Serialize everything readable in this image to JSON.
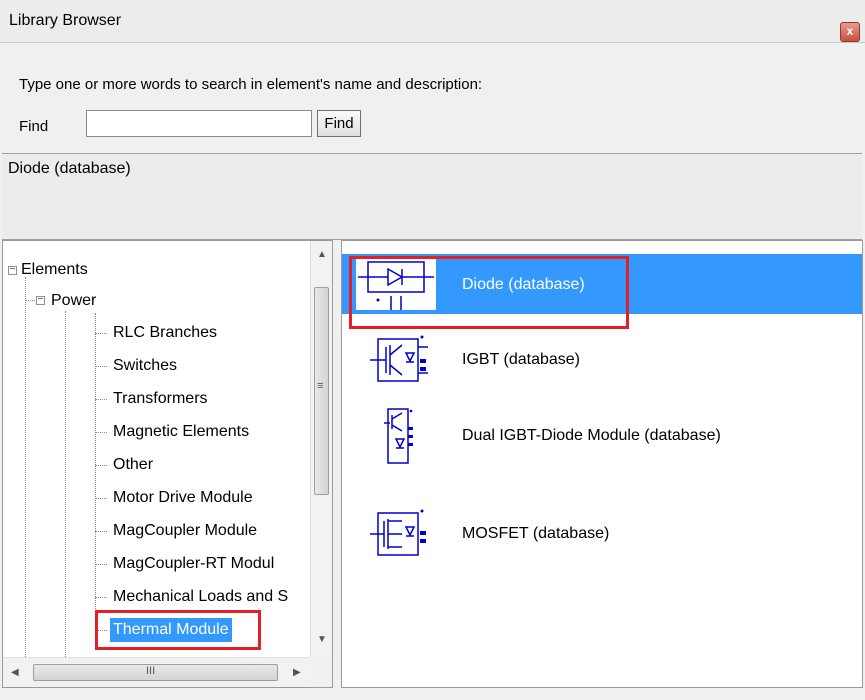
{
  "window": {
    "title": "Library Browser",
    "close_glyph": "x"
  },
  "search": {
    "instruction": "Type one or more words to search in element's name and  description:",
    "find_label": "Find",
    "find_value": "",
    "find_button": "Find"
  },
  "description": {
    "text": "Diode (database)"
  },
  "tree": {
    "root": "Elements",
    "power": "Power",
    "items": [
      "RLC Branches",
      "Switches",
      "Transformers",
      "Magnetic Elements",
      "Other",
      "Motor Drive Module",
      "MagCoupler Module",
      "MagCoupler-RT Modul",
      "Mechanical Loads and S",
      "Thermal Module"
    ],
    "selected_item": "Thermal Module",
    "scroll_h_glyph": "III",
    "scroll_v_glyph": "≡"
  },
  "list": {
    "items": [
      {
        "label": "Diode (database)",
        "icon": "diode-icon",
        "selected": true
      },
      {
        "label": "IGBT (database)",
        "icon": "igbt-icon",
        "selected": false
      },
      {
        "label": "Dual IGBT-Diode Module (database)",
        "icon": "dual-igbt-diode-icon",
        "selected": false
      },
      {
        "label": "MOSFET (database)",
        "icon": "mosfet-icon",
        "selected": false
      }
    ]
  },
  "colors": {
    "selection": "#3399ff",
    "highlight_box": "#e3202a",
    "icon_stroke": "#0000cc"
  }
}
